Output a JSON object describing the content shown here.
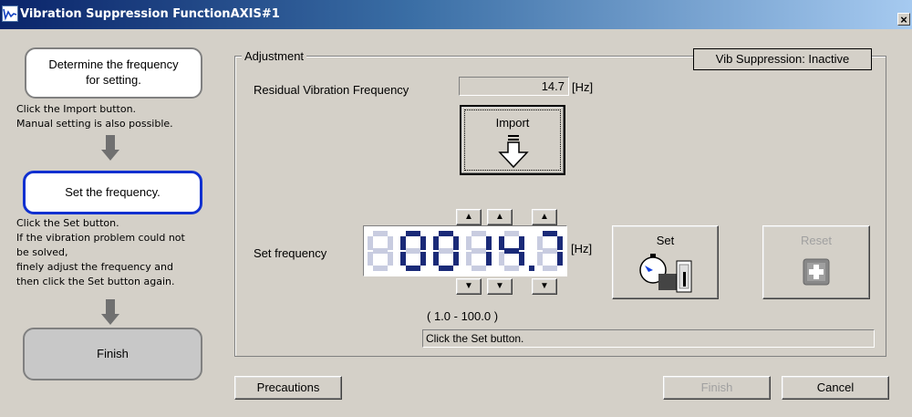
{
  "window": {
    "title": "Vibration Suppression FunctionAXIS#1",
    "close_glyph": "×"
  },
  "steps": {
    "step1": {
      "text_line1": "Determine the frequency",
      "text_line2": "for setting."
    },
    "step1_note": {
      "line1": "Click the Import button.",
      "line2": "Manual setting is also possible."
    },
    "step2": {
      "text": "Set the frequency."
    },
    "step2_note": {
      "line1": "Click the Set button.",
      "line2": "If the vibration problem could not",
      "line3": "be solved,",
      "line4": "finely adjust the frequency and",
      "line5": "then click the Set button again."
    },
    "step3": {
      "text": "Finish"
    }
  },
  "adjustment": {
    "group_label": "Adjustment",
    "status": "Vib Suppression: Inactive",
    "residual_label": "Residual Vibration Frequency",
    "residual_value": "14.7",
    "residual_unit": "[Hz]",
    "import_label": "Import",
    "set_frequency_label": "Set frequency",
    "set_frequency_digits": [
      "8",
      "0",
      "0",
      "1",
      "4",
      "7"
    ],
    "set_frequency_unit": "[Hz]",
    "up_glyph": "▲",
    "down_glyph": "▼",
    "range_text": "(   1.0 -  100.0 )",
    "set_label": "Set",
    "reset_label": "Reset",
    "message": "Click the Set button."
  },
  "footer": {
    "precautions_label": "Precautions",
    "finish_label": "Finish",
    "cancel_label": "Cancel"
  },
  "colors": {
    "title_gradient_start": "#0a246a",
    "active_step_border": "#1030d0",
    "segment_on": "#1a2a78",
    "segment_off": "#c8cce0"
  }
}
